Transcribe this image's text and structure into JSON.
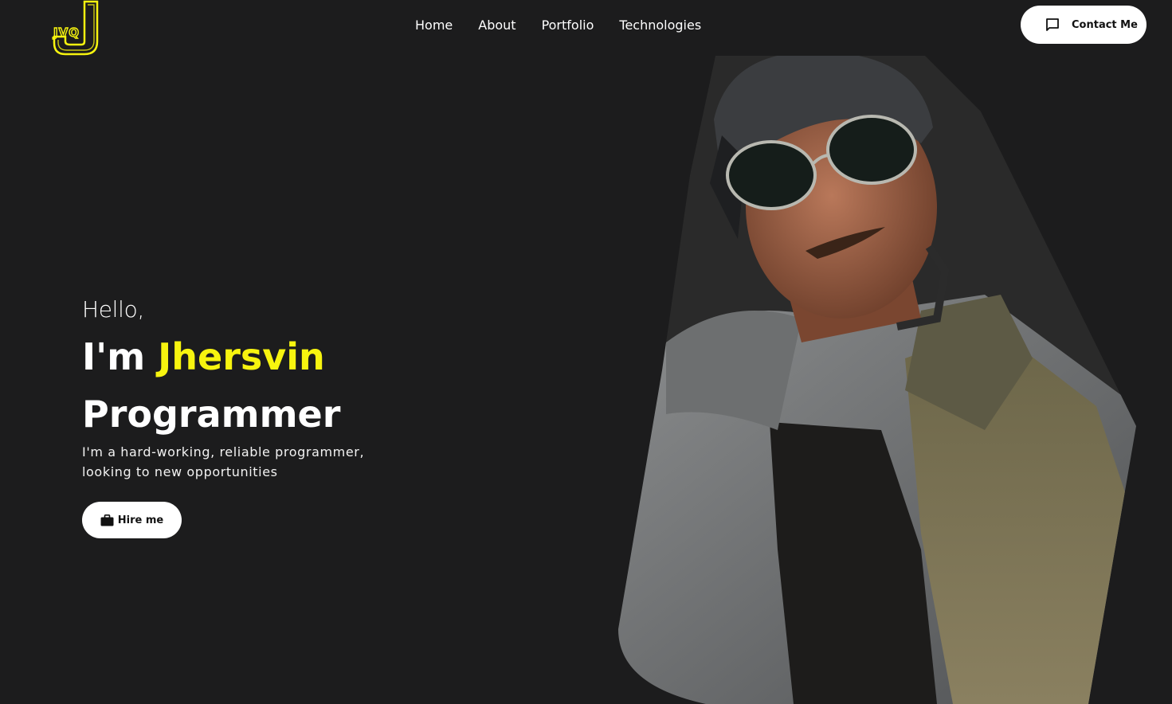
{
  "header": {
    "logo_text": "JVQ",
    "logo_color": "#f7f40f",
    "nav": [
      {
        "label": "Home"
      },
      {
        "label": "About"
      },
      {
        "label": "Portfolio"
      },
      {
        "label": "Technologies"
      }
    ],
    "contact_button": {
      "label": "Contact Me",
      "icon": "chat-bubble-icon"
    }
  },
  "hero": {
    "greeting": "Hello,",
    "intro_prefix": "I'm ",
    "name": "Jhersvin",
    "role": "Programmer",
    "description": "I'm a hard-working, reliable programmer, looking to new opportunities",
    "hire_button": {
      "label": "Hire me",
      "icon": "briefcase-icon"
    },
    "photo": {
      "subject": "portrait-photo"
    }
  },
  "colors": {
    "background": "#1c1c1d",
    "accent": "#f7f40f",
    "text": "#ffffff",
    "button_bg": "#ffffff"
  }
}
